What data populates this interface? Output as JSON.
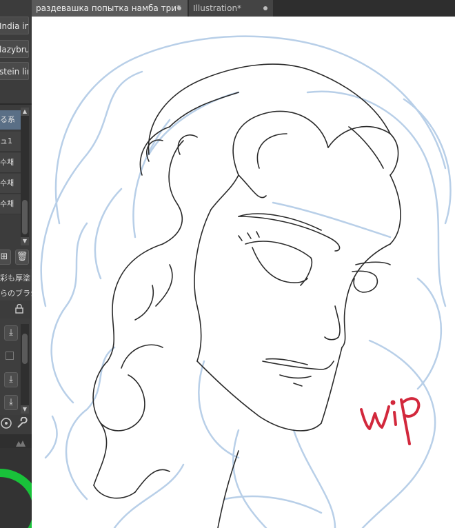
{
  "tabs": [
    {
      "label": "раздевашка попытка намба три*"
    },
    {
      "label": "Illustration*"
    }
  ],
  "left_panel": {
    "brushes": [
      "India in",
      "lazybru",
      "stein lin"
    ],
    "sub_tools": [
      "る系",
      "ュ1",
      "수채",
      "수채",
      "수채"
    ],
    "props": [
      "彩も厚塗",
      "らのブラシ"
    ],
    "icons": {
      "add": "add-layer-icon",
      "delete": "trash-icon",
      "download": "download-icon",
      "settings": "wrench-icon",
      "lock": "lock-icon"
    }
  },
  "canvas": {
    "annotation": "wip",
    "colors": {
      "background": "#ffffff",
      "lineart": "#2a2a2a",
      "sketch": "#b8cfe8",
      "annotation": "#d2283c"
    }
  }
}
